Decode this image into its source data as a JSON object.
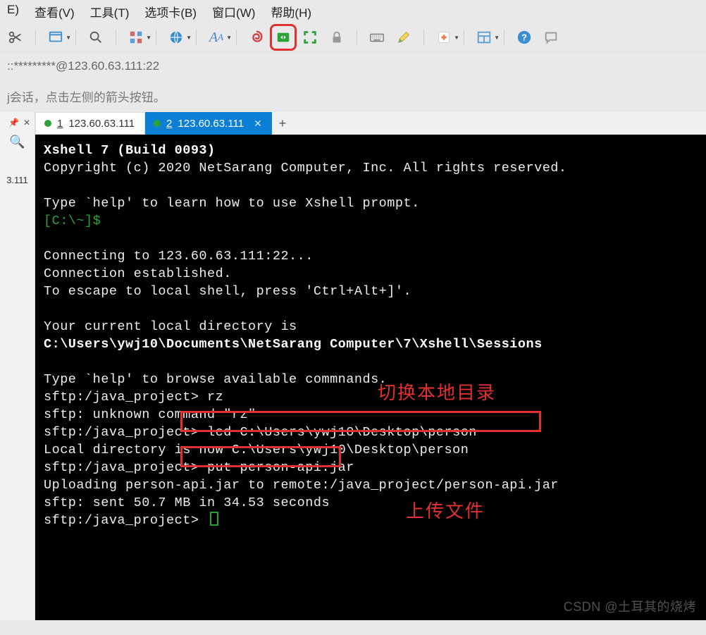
{
  "menu": {
    "edit": "E)",
    "view": "查看(V)",
    "tools": "工具(T)",
    "tabs_menu": "选项卡(B)",
    "window": "窗口(W)",
    "help": "帮助(H)"
  },
  "icons": {
    "scissors": "scissors",
    "window_dd": "window",
    "magnifier": "magnifier",
    "grid_dd": "grid",
    "globe_dd": "globe",
    "font_dd": "font",
    "swirl": "swirl",
    "transfer": "transfer",
    "fullscreen": "fullscreen",
    "lock": "lock",
    "keyboard": "keyboard",
    "pencil": "pencil",
    "plus_dd": "plus",
    "layout_dd": "layout",
    "help": "help",
    "chat": "chat"
  },
  "address_bar": "::*********@123.60.63.111:22",
  "hint_text": "j会话，点击左侧的箭头按钮。",
  "sidebar": {
    "pin": "📌",
    "close": "✕",
    "magnifier": "🔍",
    "session": "3.111"
  },
  "tabs": [
    {
      "index": "1",
      "label": "123.60.63.111",
      "active": false
    },
    {
      "index": "2",
      "label": "123.60.63.111",
      "active": true
    }
  ],
  "terminal": {
    "lines": [
      {
        "t": "Xshell 7 (Build 0093)",
        "b": true
      },
      {
        "t": "Copyright (c) 2020 NetSarang Computer, Inc. All rights reserved."
      },
      {
        "t": ""
      },
      {
        "t": "Type `help' to learn how to use Xshell prompt."
      },
      {
        "t": "[C:\\~]$",
        "g": true
      },
      {
        "t": ""
      },
      {
        "t": "Connecting to 123.60.63.111:22..."
      },
      {
        "t": "Connection established."
      },
      {
        "t": "To escape to local shell, press 'Ctrl+Alt+]'."
      },
      {
        "t": ""
      },
      {
        "t": "Your current local directory is"
      },
      {
        "t": "C:\\Users\\ywj10\\Documents\\NetSarang Computer\\7\\Xshell\\Sessions",
        "b": true
      },
      {
        "t": ""
      },
      {
        "t": "Type `help' to browse available commnands."
      },
      {
        "t": "sftp:/java_project> rz"
      },
      {
        "t": "sftp: unknown command \"rz\""
      },
      {
        "t": "sftp:/java_project> lcd C:\\Users\\ywj10\\Desktop\\person"
      },
      {
        "t": "Local directory is now C:\\Users\\ywj10\\Desktop\\person"
      },
      {
        "t": "sftp:/java_project> put person-api.jar"
      },
      {
        "t": "Uploading person-api.jar to remote:/java_project/person-api.jar"
      },
      {
        "t": "sftp: sent 50.7 MB in 34.53 seconds"
      },
      {
        "t": "sftp:/java_project> ",
        "cursor": true
      }
    ]
  },
  "annotations": {
    "label1": "切换本地目录",
    "label2": "上传文件"
  },
  "watermark": "CSDN @土耳其的烧烤"
}
